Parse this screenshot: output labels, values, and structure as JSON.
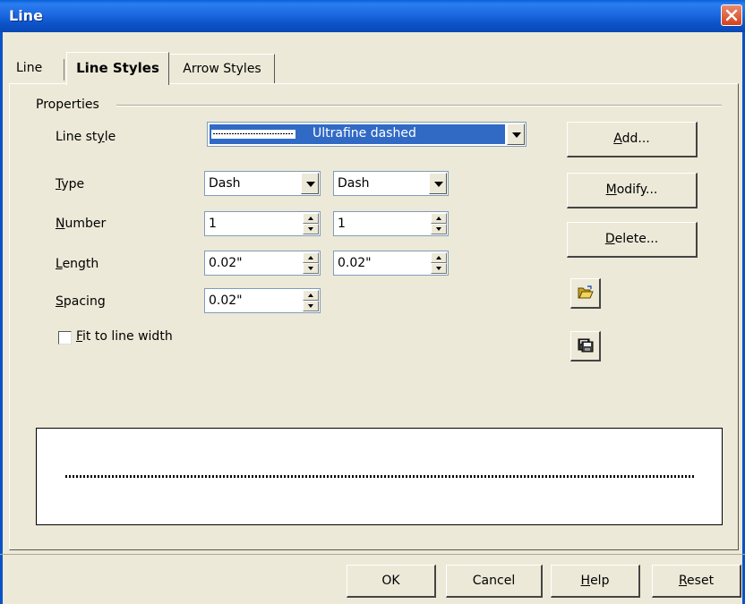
{
  "window": {
    "title": "Line",
    "close_icon": "close-icon"
  },
  "tabs": [
    "Line",
    "Line Styles",
    "Arrow Styles"
  ],
  "properties": {
    "group_label": "Properties",
    "line_style": {
      "label": "Line style",
      "value": "Ultrafine dashed"
    },
    "type": {
      "label": "Type",
      "value1": "Dash",
      "value2": "Dash"
    },
    "number": {
      "label": "Number",
      "value1": "1",
      "value2": "1"
    },
    "length": {
      "label": "Length",
      "value1": "0.02\"",
      "value2": "0.02\""
    },
    "spacing": {
      "label": "Spacing",
      "value": "0.02\""
    },
    "fit_to_line_width": {
      "label": "Fit to line width",
      "checked": false
    }
  },
  "side_buttons": {
    "add": "Add...",
    "modify": "Modify...",
    "delete": "Delete..."
  },
  "icons": {
    "load": "open-folder-icon",
    "save": "save-disk-icon"
  },
  "footer": {
    "ok": "OK",
    "cancel": "Cancel",
    "help": "Help",
    "reset": "Reset"
  }
}
